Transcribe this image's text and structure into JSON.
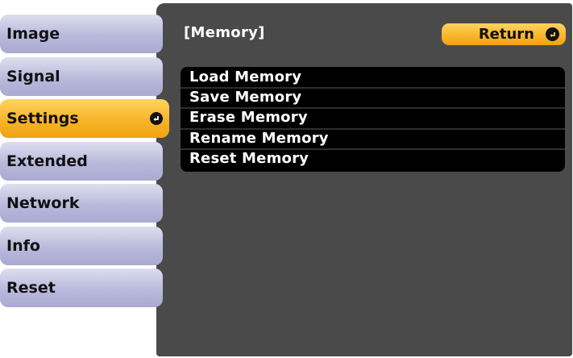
{
  "sidebar": {
    "items": [
      {
        "label": "Image"
      },
      {
        "label": "Signal"
      },
      {
        "label": "Settings"
      },
      {
        "label": "Extended"
      },
      {
        "label": "Network"
      },
      {
        "label": "Info"
      },
      {
        "label": "Reset"
      }
    ],
    "selected": "Settings"
  },
  "header": {
    "title": "[Memory]",
    "return_label": "Return"
  },
  "options": [
    {
      "label": "Load Memory"
    },
    {
      "label": "Save Memory"
    },
    {
      "label": "Erase Memory"
    },
    {
      "label": "Rename Memory"
    },
    {
      "label": "Reset Memory"
    }
  ],
  "colors": {
    "panel": "#4a4a4a",
    "menu_item": "#b9b9dc",
    "selected_accent": "#f7b429",
    "options_background": "#000000",
    "text_light": "#ffffff"
  },
  "icons": {
    "enter": "enter-icon"
  }
}
